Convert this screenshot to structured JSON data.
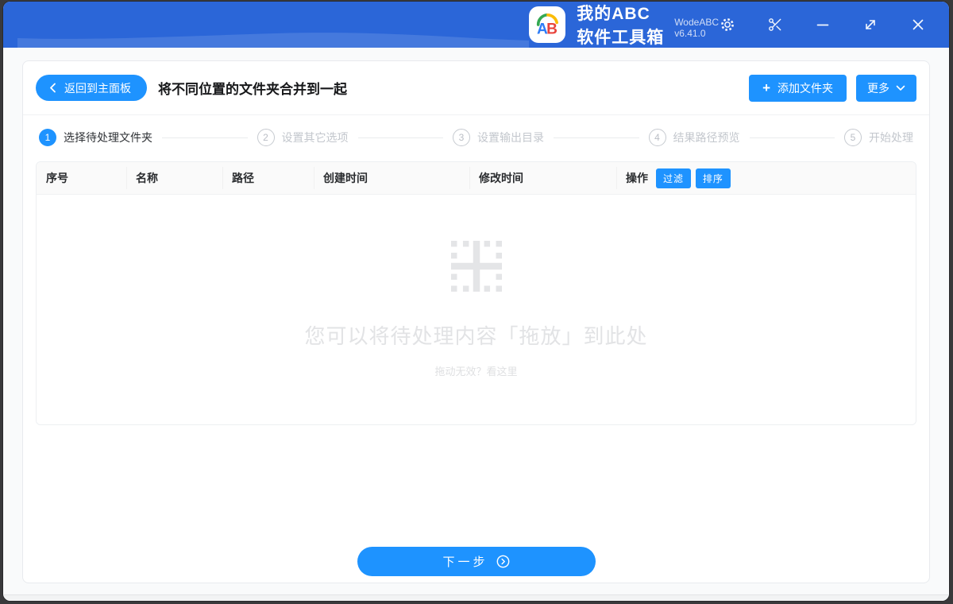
{
  "titlebar": {
    "logo_text": "AB",
    "app_title": "我的ABC软件工具箱",
    "version": "WodeABC v6.41.0",
    "icons": [
      "settings-gear",
      "scissors",
      "minimize",
      "resize",
      "close"
    ]
  },
  "header": {
    "back_label": "返回到主面板",
    "page_title": "将不同位置的文件夹合并到一起",
    "add_folder_label": "添加文件夹",
    "add_plus": "+",
    "more_label": "更多"
  },
  "steps": [
    {
      "num": "1",
      "label": "选择待处理文件夹",
      "active": true
    },
    {
      "num": "2",
      "label": "设置其它选项",
      "active": false
    },
    {
      "num": "3",
      "label": "设置输出目录",
      "active": false
    },
    {
      "num": "4",
      "label": "结果路径预览",
      "active": false
    },
    {
      "num": "5",
      "label": "开始处理",
      "active": false
    }
  ],
  "table": {
    "columns": [
      "序号",
      "名称",
      "路径",
      "创建时间",
      "修改时间",
      "操作"
    ],
    "filter_label": "过滤",
    "sort_label": "排序",
    "rows": []
  },
  "dropzone": {
    "main_text": "您可以将待处理内容「拖放」到此处",
    "hint_text": "拖动无效？看这里"
  },
  "footer": {
    "next_label": "下一步"
  },
  "colors": {
    "accent": "#1e93ff",
    "titlebar_dark": "#2b66d8",
    "titlebar_wave": "#4579dd",
    "logo_a": "#2e7cf6",
    "logo_b": "#e8443c",
    "logo_arc_left": "#34a853",
    "logo_arc_right": "#fbbc05"
  }
}
